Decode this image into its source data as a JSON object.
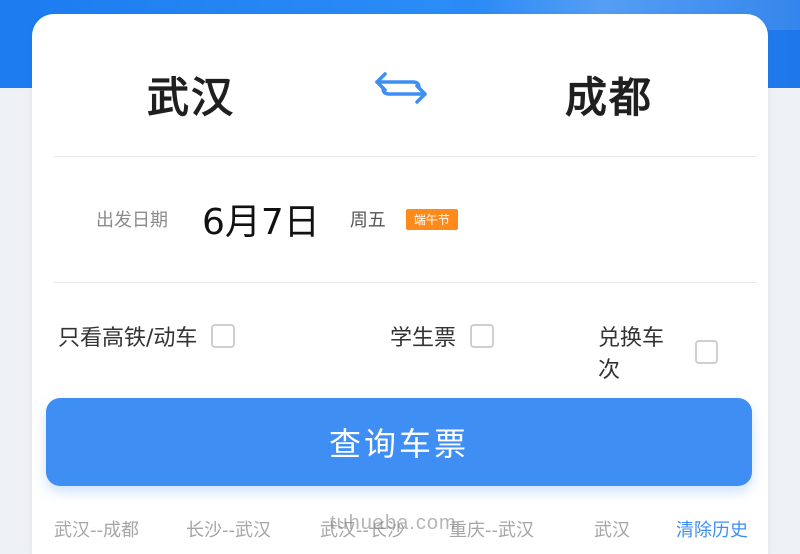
{
  "route": {
    "from": "武汉",
    "to": "成都"
  },
  "date": {
    "label": "出发日期",
    "value": "6月7日",
    "weekday": "周五",
    "holiday": "端午节"
  },
  "options": [
    {
      "label": "只看高铁/动车",
      "checked": false
    },
    {
      "label": "学生票",
      "checked": false
    },
    {
      "label": "兑换车次",
      "checked": false
    }
  ],
  "search_button": "查询车票",
  "history": {
    "items": [
      "武汉--成都",
      "长沙--武汉",
      "武汉--长沙",
      "重庆--武汉",
      "武汉"
    ],
    "clear_label": "清除历史"
  },
  "watermark": "tuhuaba.com",
  "colors": {
    "primary": "#3f8ef3",
    "banner": "#1c7cf0",
    "holiday_badge": "#ff8a1c"
  },
  "icons": {
    "swap": "swap-arrows-icon"
  }
}
